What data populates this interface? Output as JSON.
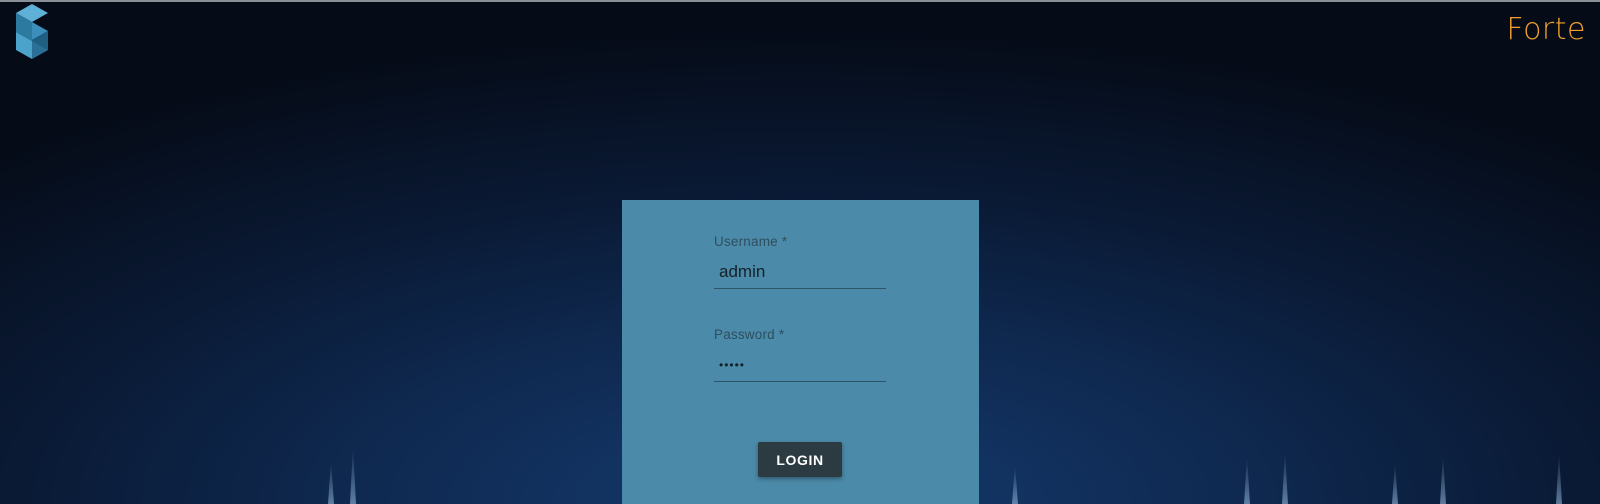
{
  "header": {
    "brand": "Forte",
    "brand_color": "#f0a030",
    "logo_icon": "s-cube-logo-icon"
  },
  "login_form": {
    "username_label": "Username *",
    "username_value": "admin",
    "password_label": "Password *",
    "password_value": "•••••",
    "login_label": "LOGIN",
    "card_color": "#4b8aa8",
    "button_color": "#2c3a41"
  }
}
